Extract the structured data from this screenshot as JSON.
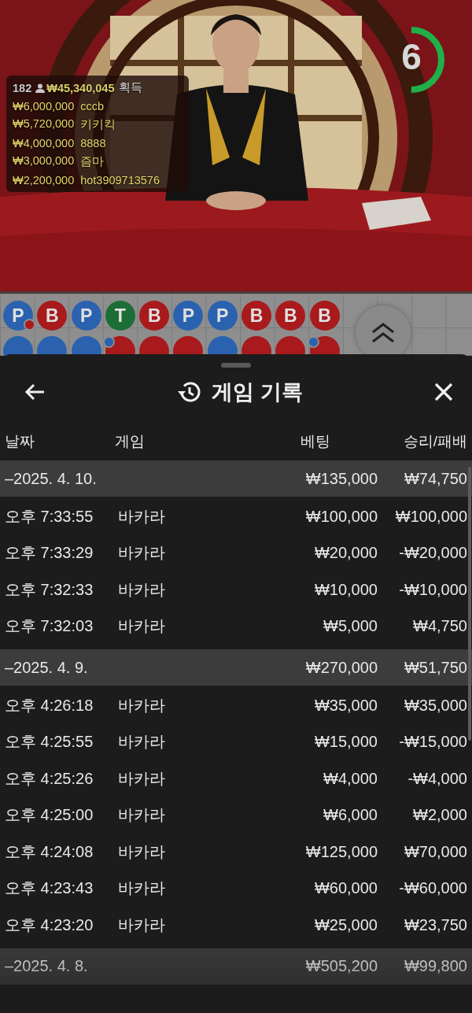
{
  "video": {
    "kind": "picture",
    "players_count": "182",
    "total_won": "₩45,340,045",
    "total_won_label": "획득",
    "winners": [
      {
        "amount": "₩6,000,000",
        "name": "cccb"
      },
      {
        "amount": "₩5,720,000",
        "name": "키키킥"
      },
      {
        "amount": "₩4,000,000",
        "name": "8888"
      },
      {
        "amount": "₩3,000,000",
        "name": "즘마"
      },
      {
        "amount": "₩2,200,000",
        "name": "hot3909713576"
      }
    ],
    "timer": {
      "value": "6",
      "level": 0.5
    }
  },
  "bead_road": {
    "rows": [
      [
        {
          "result": "P",
          "kind": "player",
          "banker_pair": true
        },
        {
          "result": "B",
          "kind": "banker"
        },
        {
          "result": "P",
          "kind": "player"
        },
        {
          "result": "T",
          "kind": "tie"
        },
        {
          "result": "B",
          "kind": "banker"
        },
        {
          "result": "P",
          "kind": "player"
        },
        {
          "result": "P",
          "kind": "player"
        },
        {
          "result": "B",
          "kind": "banker"
        },
        {
          "result": "B",
          "kind": "banker"
        },
        {
          "result": "B",
          "kind": "banker"
        }
      ],
      [
        {
          "kind": "player"
        },
        {
          "kind": "player"
        },
        {
          "kind": "player"
        },
        {
          "kind": "banker",
          "player_pair": true
        },
        {
          "kind": "banker"
        },
        {
          "kind": "banker"
        },
        {
          "kind": "player"
        },
        {
          "kind": "banker"
        },
        {
          "kind": "banker"
        },
        {
          "kind": "banker",
          "player_pair": true
        }
      ]
    ]
  },
  "sheet": {
    "title": "게임 기록",
    "columns": [
      "날짜",
      "게임",
      "베팅",
      "승리/패배"
    ],
    "groups": [
      {
        "date": "–2025. 4. 10.",
        "bet": "₩135,000",
        "result": "₩74,750",
        "rows": [
          {
            "time": "오후 7:33:55",
            "game": "바카라",
            "bet": "₩100,000",
            "result": "₩100,000"
          },
          {
            "time": "오후 7:33:29",
            "game": "바카라",
            "bet": "₩20,000",
            "result": "-₩20,000"
          },
          {
            "time": "오후 7:32:33",
            "game": "바카라",
            "bet": "₩10,000",
            "result": "-₩10,000"
          },
          {
            "time": "오후 7:32:03",
            "game": "바카라",
            "bet": "₩5,000",
            "result": "₩4,750"
          }
        ]
      },
      {
        "date": "–2025. 4. 9.",
        "bet": "₩270,000",
        "result": "₩51,750",
        "rows": [
          {
            "time": "오후 4:26:18",
            "game": "바카라",
            "bet": "₩35,000",
            "result": "₩35,000"
          },
          {
            "time": "오후 4:25:55",
            "game": "바카라",
            "bet": "₩15,000",
            "result": "-₩15,000"
          },
          {
            "time": "오후 4:25:26",
            "game": "바카라",
            "bet": "₩4,000",
            "result": "-₩4,000"
          },
          {
            "time": "오후 4:25:00",
            "game": "바카라",
            "bet": "₩6,000",
            "result": "₩2,000"
          },
          {
            "time": "오후 4:24:08",
            "game": "바카라",
            "bet": "₩125,000",
            "result": "₩70,000"
          },
          {
            "time": "오후 4:23:43",
            "game": "바카라",
            "bet": "₩60,000",
            "result": "-₩60,000"
          },
          {
            "time": "오후 4:23:20",
            "game": "바카라",
            "bet": "₩25,000",
            "result": "₩23,750"
          }
        ]
      },
      {
        "date": "–2025. 4. 8.",
        "bet": "₩505,200",
        "result": "₩99,800"
      }
    ]
  }
}
